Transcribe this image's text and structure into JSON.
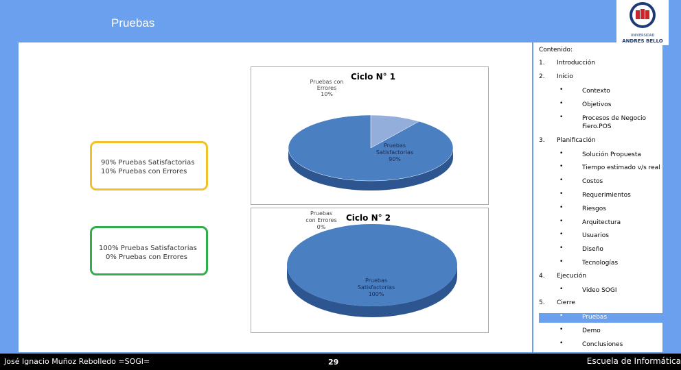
{
  "header": {
    "title": "Pruebas"
  },
  "logo": {
    "line1": "UNIVERSIDAD",
    "line2": "ANDRES BELLO"
  },
  "boxes": [
    {
      "line1": "90%  Pruebas Satisfactorias",
      "line2": "10%  Pruebas con Errores",
      "color": "#f2c02a"
    },
    {
      "line1": "100%  Pruebas Satisfactorias",
      "line2": "0%  Pruebas con Errores",
      "color": "#2fae4a"
    }
  ],
  "chart_data": [
    {
      "type": "pie",
      "title": "Ciclo N° 1",
      "labels": [
        "Pruebas con Errores 10%",
        "Pruebas Satisfactorias 90%"
      ],
      "values": [
        10,
        90
      ],
      "colors": [
        "#94aedc",
        "#4a7fc1"
      ]
    },
    {
      "type": "pie",
      "title": "Ciclo N° 2",
      "labels": [
        "Pruebas con Errores 0%",
        "Pruebas Satisfactorias 100%"
      ],
      "values": [
        0,
        100
      ],
      "colors": [
        "#94aedc",
        "#4a7fc1"
      ]
    }
  ],
  "chart_text": {
    "c1_err": [
      "Pruebas con",
      "Errores",
      "10%"
    ],
    "c1_ok": [
      "Pruebas",
      "Satisfactorias",
      "90%"
    ],
    "c2_err": [
      "Pruebas",
      "con Errores",
      "0%"
    ],
    "c2_ok": [
      "Pruebas",
      "Satisfactorias",
      "100%"
    ]
  },
  "toc": {
    "heading": "Contenido:",
    "items": [
      {
        "kind": "num",
        "num": "1.",
        "label": "Introducción"
      },
      {
        "kind": "num",
        "num": "2.",
        "label": "Inicio"
      },
      {
        "kind": "sub",
        "bullet": "•",
        "label": "Contexto"
      },
      {
        "kind": "sub",
        "bullet": "•",
        "label": "Objetivos"
      },
      {
        "kind": "sub",
        "bullet": "•",
        "label": "Procesos de Negocio Fiero.POS"
      },
      {
        "kind": "num",
        "num": "3.",
        "label": "Planificación"
      },
      {
        "kind": "sub",
        "bullet": "•",
        "label": "Solución Propuesta"
      },
      {
        "kind": "sub",
        "bullet": "•",
        "label": "Tiempo estimado v/s real"
      },
      {
        "kind": "sub",
        "bullet": "•",
        "label": "Costos"
      },
      {
        "kind": "sub",
        "bullet": "•",
        "label": "Requerimientos"
      },
      {
        "kind": "sub",
        "bullet": "•",
        "label": "Riesgos"
      },
      {
        "kind": "sub",
        "bullet": "•",
        "label": "Arquitectura"
      },
      {
        "kind": "sub",
        "bullet": "•",
        "label": "Usuarios"
      },
      {
        "kind": "sub",
        "bullet": "•",
        "label": "Diseño"
      },
      {
        "kind": "sub",
        "bullet": "•",
        "label": "Tecnologías"
      },
      {
        "kind": "num",
        "num": "4.",
        "label": "Ejecución"
      },
      {
        "kind": "sub",
        "bullet": "•",
        "label": "Video SOGI"
      },
      {
        "kind": "num",
        "num": "5.",
        "label": "Cierre"
      },
      {
        "kind": "sub",
        "bullet": "•",
        "label": "Pruebas",
        "active": true
      },
      {
        "kind": "sub",
        "bullet": "•",
        "label": "Demo"
      },
      {
        "kind": "sub",
        "bullet": "•",
        "label": "Conclusiones"
      }
    ]
  },
  "footer": {
    "author": "José Ignacio Muñoz Rebolledo =SOGI=",
    "page": "29",
    "school": "Escuela de Informática"
  },
  "accent": "#6aa0ee"
}
